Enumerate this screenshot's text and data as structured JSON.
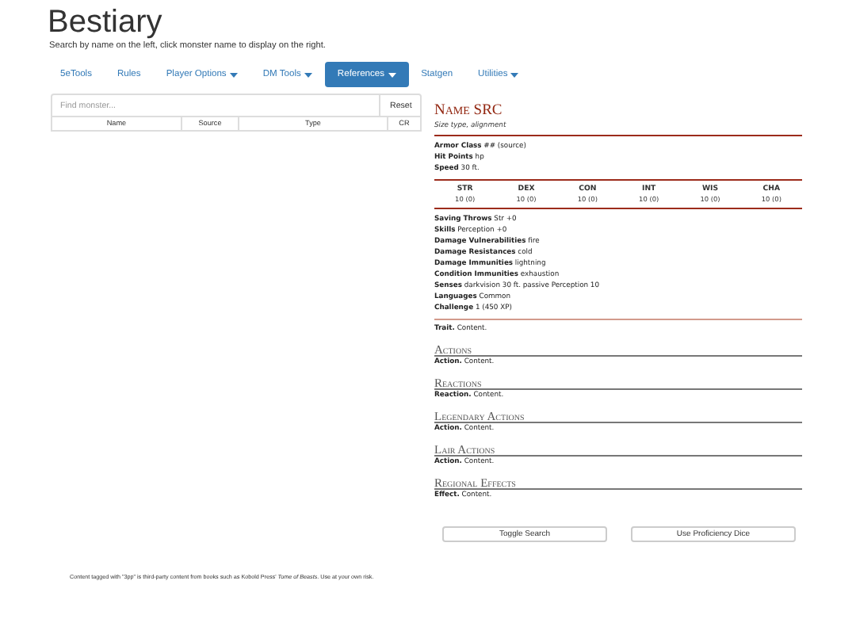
{
  "title": "Bestiary",
  "subtitle": "Search by name on the left, click monster name to display on the right.",
  "nav": [
    {
      "label": "5eTools",
      "dropdown": false,
      "selected": false
    },
    {
      "label": "Rules",
      "dropdown": false,
      "selected": false
    },
    {
      "label": "Player Options",
      "dropdown": true,
      "selected": false
    },
    {
      "label": "DM Tools",
      "dropdown": true,
      "selected": false
    },
    {
      "label": "References",
      "dropdown": true,
      "selected": true
    },
    {
      "label": "Statgen",
      "dropdown": false,
      "selected": false
    },
    {
      "label": "Utilities",
      "dropdown": true,
      "selected": false
    }
  ],
  "search": {
    "placeholder": "Find monster...",
    "reset": "Reset"
  },
  "columns": [
    "Name",
    "Source",
    "Type",
    "CR"
  ],
  "statblock": {
    "name": "Name SRC",
    "meta": "Size type, alignment",
    "basics": [
      {
        "label": "Armor Class",
        "value": "## (source)"
      },
      {
        "label": "Hit Points",
        "value": "hp"
      },
      {
        "label": "Speed",
        "value": "30 ft."
      }
    ],
    "abilities": [
      {
        "label": "STR",
        "value": "10 (0)"
      },
      {
        "label": "DEX",
        "value": "10 (0)"
      },
      {
        "label": "CON",
        "value": "10 (0)"
      },
      {
        "label": "INT",
        "value": "10 (0)"
      },
      {
        "label": "WIS",
        "value": "10 (0)"
      },
      {
        "label": "CHA",
        "value": "10 (0)"
      }
    ],
    "details": [
      {
        "label": "Saving Throws",
        "value": "Str +0"
      },
      {
        "label": "Skills",
        "value": "Perception +0"
      },
      {
        "label": "Damage Vulnerabilities",
        "value": "fire"
      },
      {
        "label": "Damage Resistances",
        "value": "cold"
      },
      {
        "label": "Damage Immunities",
        "value": "lightning"
      },
      {
        "label": "Condition Immunities",
        "value": "exhaustion"
      },
      {
        "label": "Senses",
        "value": "darkvision 30 ft. passive Perception 10"
      },
      {
        "label": "Languages",
        "value": "Common"
      },
      {
        "label": "Challenge",
        "value": "1 (450 XP)"
      }
    ],
    "traits": [
      {
        "name": "Trait.",
        "text": "Content."
      }
    ],
    "sections": [
      {
        "title": "Actions",
        "entries": [
          {
            "name": "Action.",
            "text": "Content."
          }
        ]
      },
      {
        "title": "Reactions",
        "entries": [
          {
            "name": "Reaction.",
            "text": "Content."
          }
        ]
      },
      {
        "title": "Legendary Actions",
        "entries": [
          {
            "name": "Action.",
            "text": "Content."
          }
        ]
      },
      {
        "title": "Lair Actions",
        "entries": [
          {
            "name": "Action.",
            "text": "Content."
          }
        ]
      },
      {
        "title": "Regional Effects",
        "entries": [
          {
            "name": "Effect.",
            "text": "Content."
          }
        ]
      }
    ]
  },
  "buttons": [
    "Toggle Search",
    "Use Proficiency Dice"
  ],
  "footer": "Content tagged with \"3pp\" is third-party content from books such as Kobold Press' *Tome of Beasts*. Use at your own risk."
}
